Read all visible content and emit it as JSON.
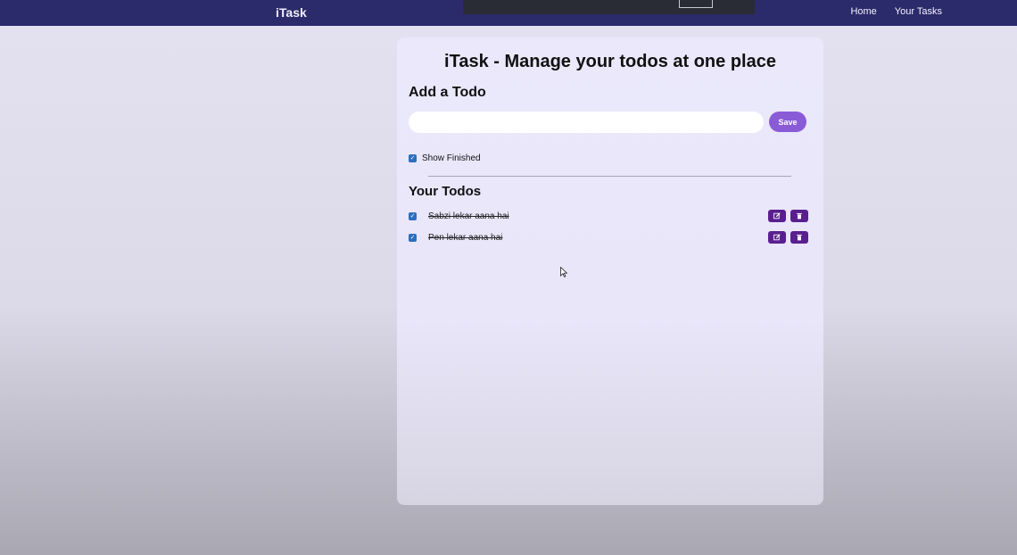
{
  "navbar": {
    "brand": "iTask",
    "links": [
      "Home",
      "Your Tasks"
    ]
  },
  "card": {
    "title": "iTask - Manage your todos at one place",
    "add_heading": "Add a Todo",
    "input": {
      "value": "",
      "placeholder": ""
    },
    "save_label": "Save",
    "show_finished": {
      "label": "Show Finished",
      "checked": true
    },
    "todos_heading": "Your Todos",
    "todos": [
      {
        "text": "Sabzi lekar aana hai",
        "completed": true
      },
      {
        "text": "Pen lekar aana hai",
        "completed": true
      }
    ],
    "icons": {
      "edit": "edit-icon",
      "delete": "trash-icon"
    }
  },
  "colors": {
    "navbar": "#2b2a6b",
    "save_button": "#8a5bd6",
    "action_button": "#5a1f8f",
    "checkbox": "#2b6fbf"
  }
}
